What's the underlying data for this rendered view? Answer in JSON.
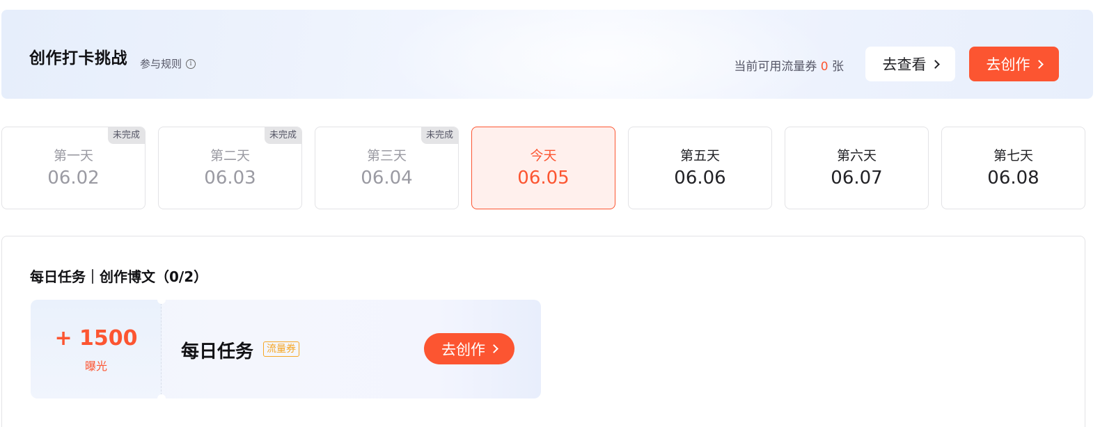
{
  "banner": {
    "title": "创作打卡挑战",
    "rules_label": "参与规则",
    "info_icon": "i",
    "available_prefix": "当前可用流量券",
    "available_count": "0",
    "available_suffix": "张",
    "view_button": "去查看",
    "create_button": "去创作"
  },
  "days": [
    {
      "name": "第一天",
      "date": "06.02",
      "badge": "未完成"
    },
    {
      "name": "第二天",
      "date": "06.03",
      "badge": "未完成"
    },
    {
      "name": "第三天",
      "date": "06.04",
      "badge": "未完成"
    },
    {
      "name": "今天",
      "date": "06.05"
    },
    {
      "name": "第五天",
      "date": "06.06"
    },
    {
      "name": "第六天",
      "date": "06.07"
    },
    {
      "name": "第七天",
      "date": "06.08"
    }
  ],
  "task_section": {
    "title": "每日任务｜创作博文（0/2）",
    "card": {
      "reward_value": "+ 1500",
      "reward_unit": "曝光",
      "name": "每日任务",
      "tag": "流量券",
      "button": "去创作"
    }
  },
  "colors": {
    "accent": "#fc5531",
    "tag": "#f5a623",
    "muted": "#9a9aa2"
  }
}
